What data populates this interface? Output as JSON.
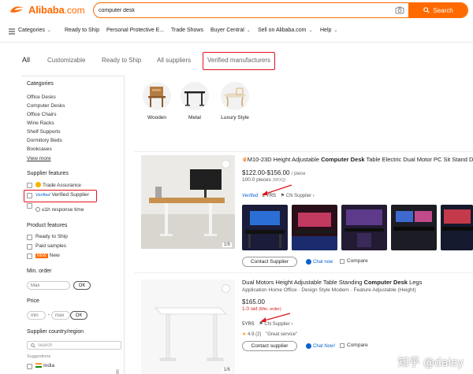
{
  "header": {
    "logo_word": "Alibaba",
    "logo_suffix": ".com",
    "search_value": "computer desk",
    "search_button": "Search"
  },
  "nav": {
    "items": [
      "Categories",
      "Ready to Ship",
      "Personal Protective E...",
      "Trade Shows",
      "Buyer Central",
      "Sell on Alibaba.com",
      "Help"
    ]
  },
  "tabs": [
    "All",
    "Customizable",
    "Ready to Ship",
    "All suppliers",
    "Verified manufacturers"
  ],
  "sidebar": {
    "categories_title": "Categories",
    "categories": [
      "Office Desks",
      "Computer Desks",
      "Office Chairs",
      "Wine Racks",
      "Shelf Supports",
      "Dormitory Beds",
      "Bookcases"
    ],
    "view_more": "View more",
    "supplier_features_title": "Supplier features",
    "supplier_features": [
      "Trade Assurance",
      "Verified Supplier",
      "≤1h response time"
    ],
    "verified_badge": "Verified",
    "product_features_title": "Product features",
    "product_features": [
      "Ready to Ship",
      "Paid samples",
      "New"
    ],
    "new_badge": "NEW",
    "min_order_title": "Min. order",
    "min_order_placeholder": "Max",
    "ok": "OK",
    "price_title": "Price",
    "price_min": "min",
    "price_dash": "-",
    "price_max": "max",
    "country_title": "Supplier country/region",
    "country_search": "search",
    "suggestions": "Suggestions",
    "country_first": "India"
  },
  "categories_chips": [
    "Wooden",
    "Metal",
    "Luxury Style"
  ],
  "products": [
    {
      "title_pre": "M10-23D Height Adjustable ",
      "title_bold": "Computer Desk",
      "title_post": " Table Electric Dual Motor PC Sit Stand D",
      "price": "$122.00-$156.00",
      "unit": "/ piece",
      "moq": "100.0 pieces",
      "moq_note": "(MOQ)",
      "verified": "Verified",
      "years": "2 YRS",
      "supplier": "CN Supplier",
      "pager": "1/6",
      "contact": "Contact Supplier",
      "chat": "Chat now",
      "compare": "Compare"
    },
    {
      "title_pre": "Dual Motors Height Adjustable Table Standing ",
      "title_bold": "Computer Desk",
      "title_post": " Legs",
      "attrs": "Application Home Office · Design Style Modern · Feature Adjustable (Height)",
      "price": "$165.00",
      "moq": "1.0 set",
      "moq_note": "(Min. order)",
      "years": "5YRS",
      "supplier": "CN Supplier",
      "rating": "4.9",
      "reviews": "(2)",
      "review_quote": "\"Great service\"",
      "pager": "1/6",
      "contact": "Contact supplier",
      "chat": "Chat Now!",
      "compare": "Compare"
    }
  ],
  "watermark": "知乎 @daisy",
  "colors": {
    "brand": "#ff6a00",
    "highlight": "#e0141e",
    "link_blue": "#0a62cc"
  }
}
